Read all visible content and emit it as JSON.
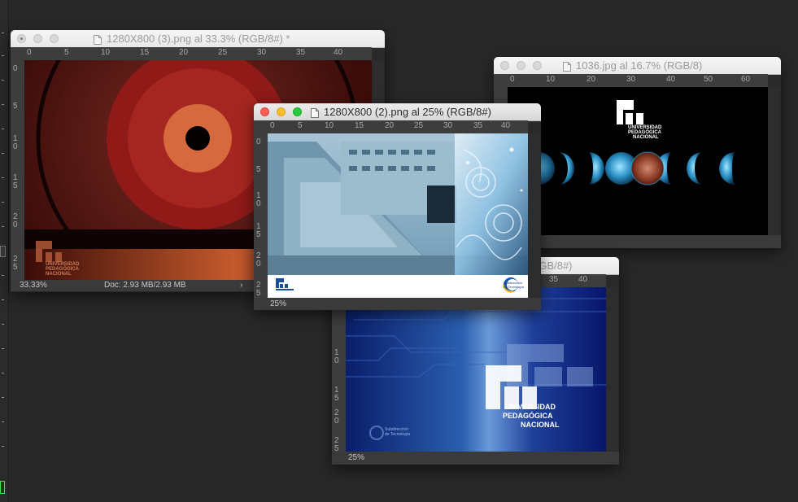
{
  "window_1": {
    "title": "1280X800 (3).png al 33.3% (RGB/8#) *",
    "ruler_h": [
      "0",
      "5",
      "10",
      "15",
      "20",
      "25",
      "30",
      "35",
      "40"
    ],
    "ruler_v": [
      "0",
      "5",
      "1\n0",
      "1\n5",
      "2\n0",
      "2\n5"
    ],
    "zoom": "33.33%",
    "doc_info": "Doc: 2.93 MB/2.93 MB",
    "status_arrow": "›",
    "logo_line1": "UNIVERSIDAD",
    "logo_line2": "PEDAGÓGICA",
    "logo_line3": "NACIONAL"
  },
  "window_2": {
    "title": "1036.jpg al 16.7% (RGB/8)",
    "ruler_h": [
      "0",
      "10",
      "20",
      "30",
      "40",
      "50",
      "60"
    ],
    "logo_line1": "UNIVERSIDAD",
    "logo_line2": "PEDAGÓGICA",
    "logo_line3": "NACIONAL"
  },
  "window_3": {
    "title_visible": "(GB/8#)",
    "ruler_h": [
      "35",
      "40"
    ],
    "ruler_v": [
      "1\n0",
      "1\n5",
      "2\n0",
      "2\n5"
    ],
    "zoom": "25%",
    "logo_line1": "UNIVERSIDAD",
    "logo_line2": "PEDAGÓGICA",
    "logo_line3": "NACIONAL",
    "bottom_logo_line1": "Subdirección",
    "bottom_logo_line2": "de Tecnología"
  },
  "window_4": {
    "title": "1280X800 (2).png al 25% (RGB/8#)",
    "ruler_h": [
      "0",
      "5",
      "10",
      "15",
      "20",
      "25",
      "30",
      "35",
      "40"
    ],
    "ruler_v": [
      "0",
      "5",
      "1\n0",
      "1\n5",
      "2\n0",
      "2\n5"
    ],
    "zoom": "25%",
    "corner_logo_line1": "Subdirección",
    "corner_logo_line2": "de Tecnología"
  },
  "colors": {
    "window_active_red": "#fd5f57",
    "window_active_yellow": "#febc2e",
    "window_active_green": "#28c840",
    "workspace": "#282828"
  }
}
